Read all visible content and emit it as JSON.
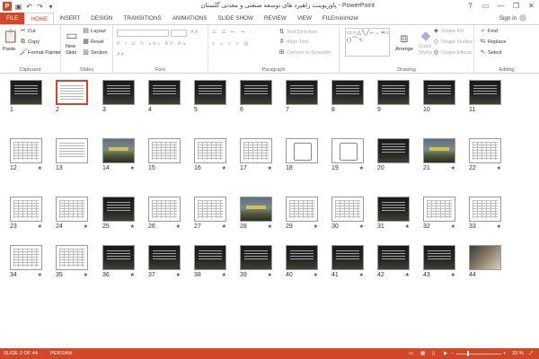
{
  "window": {
    "title": "پاورپوینت راهبرد های توسعه صنعتی و معدنی گلستان - PowerPoint",
    "app_logo": "P",
    "sign_in": "Sign in"
  },
  "tabs": [
    {
      "label": "FILE"
    },
    {
      "label": "HOME"
    },
    {
      "label": "INSERT"
    },
    {
      "label": "DESIGN"
    },
    {
      "label": "TRANSITIONS"
    },
    {
      "label": "ANIMATIONS"
    },
    {
      "label": "SLIDE SHOW"
    },
    {
      "label": "REVIEW"
    },
    {
      "label": "VIEW"
    },
    {
      "label": "FILEminimizer"
    }
  ],
  "ribbon": {
    "clipboard": {
      "label": "Clipboard",
      "paste": "Paste",
      "cut": "Cut",
      "copy": "Copy",
      "format_painter": "Format Painter"
    },
    "slides": {
      "label": "Slides",
      "new_slide": "New",
      "new_slide2": "Slide",
      "layout": "Layout",
      "reset": "Reset",
      "section": "Section"
    },
    "font": {
      "label": "Font"
    },
    "paragraph": {
      "label": "Paragraph",
      "text_direction": "Text Direction",
      "align_text": "Align Text",
      "convert_smartart": "Convert to SmartArt"
    },
    "drawing": {
      "label": "Drawing",
      "arrange": "Arrange",
      "quick_styles": "Quick",
      "quick_styles2": "Styles",
      "shape_fill": "Shape Fill",
      "shape_outline": "Shape Outline",
      "shape_effects": "Shape Effects"
    },
    "editing": {
      "label": "Editing",
      "find": "Find",
      "replace": "Replace",
      "select": "Select"
    }
  },
  "slides": [
    {
      "n": "1",
      "star": "",
      "style": "dark"
    },
    {
      "n": "2",
      "star": "",
      "style": "text",
      "selected": true
    },
    {
      "n": "3",
      "star": "",
      "style": "dark"
    },
    {
      "n": "4",
      "star": "",
      "style": "dark"
    },
    {
      "n": "5",
      "star": "",
      "style": "dark"
    },
    {
      "n": "6",
      "star": "",
      "style": "dark"
    },
    {
      "n": "7",
      "star": "",
      "style": "dark"
    },
    {
      "n": "8",
      "star": "",
      "style": "dark"
    },
    {
      "n": "9",
      "star": "",
      "style": "dark"
    },
    {
      "n": "10",
      "star": "",
      "style": "dark"
    },
    {
      "n": "11",
      "star": "",
      "style": "dark"
    },
    {
      "n": "12",
      "star": "★",
      "style": "table"
    },
    {
      "n": "13",
      "star": "",
      "style": "text"
    },
    {
      "n": "14",
      "star": "★",
      "style": "landscape"
    },
    {
      "n": "15",
      "star": "",
      "style": "table"
    },
    {
      "n": "16",
      "star": "★",
      "style": "table"
    },
    {
      "n": "17",
      "star": "★",
      "style": "table"
    },
    {
      "n": "18",
      "star": "",
      "style": "diagram"
    },
    {
      "n": "19",
      "star": "★",
      "style": "diagram"
    },
    {
      "n": "20",
      "star": "",
      "style": "dark"
    },
    {
      "n": "21",
      "star": "★",
      "style": "landscape"
    },
    {
      "n": "22",
      "star": "★",
      "style": "table"
    },
    {
      "n": "23",
      "star": "★",
      "style": "table"
    },
    {
      "n": "24",
      "star": "★",
      "style": "table"
    },
    {
      "n": "25",
      "star": "★",
      "style": "dark"
    },
    {
      "n": "26",
      "star": "★",
      "style": "table"
    },
    {
      "n": "27",
      "star": "★",
      "style": "table"
    },
    {
      "n": "28",
      "star": "★",
      "style": "landscape"
    },
    {
      "n": "29",
      "star": "★",
      "style": "table"
    },
    {
      "n": "30",
      "star": "★",
      "style": "table"
    },
    {
      "n": "31",
      "star": "★",
      "style": "dark"
    },
    {
      "n": "32",
      "star": "★",
      "style": "table"
    },
    {
      "n": "33",
      "star": "★",
      "style": "table"
    },
    {
      "n": "34",
      "star": "★",
      "style": "table"
    },
    {
      "n": "35",
      "star": "★",
      "style": "table"
    },
    {
      "n": "36",
      "star": "★",
      "style": "dark"
    },
    {
      "n": "37",
      "star": "★",
      "style": "dark"
    },
    {
      "n": "38",
      "star": "★",
      "style": "dark"
    },
    {
      "n": "39",
      "star": "★",
      "style": "dark"
    },
    {
      "n": "40",
      "star": "★",
      "style": "dark"
    },
    {
      "n": "41",
      "star": "★",
      "style": "dark"
    },
    {
      "n": "42",
      "star": "★",
      "style": "dark"
    },
    {
      "n": "43",
      "star": "★",
      "style": "dark"
    },
    {
      "n": "44",
      "star": "",
      "style": "photo"
    }
  ],
  "status": {
    "slide_info": "SLIDE 2 OF 44",
    "language": "PERSIAN",
    "zoom": "33 %",
    "zoom_minus": "−",
    "zoom_plus": "+"
  },
  "colors": {
    "accent": "#d24726"
  },
  "icons": [
    "powerpoint-logo-icon",
    "save-icon",
    "undo-icon",
    "redo-icon",
    "cut-icon",
    "copy-icon",
    "paste-icon",
    "format-painter-icon",
    "find-icon",
    "replace-icon",
    "select-icon",
    "help-icon",
    "minimize-icon",
    "restore-icon",
    "close-icon"
  ]
}
